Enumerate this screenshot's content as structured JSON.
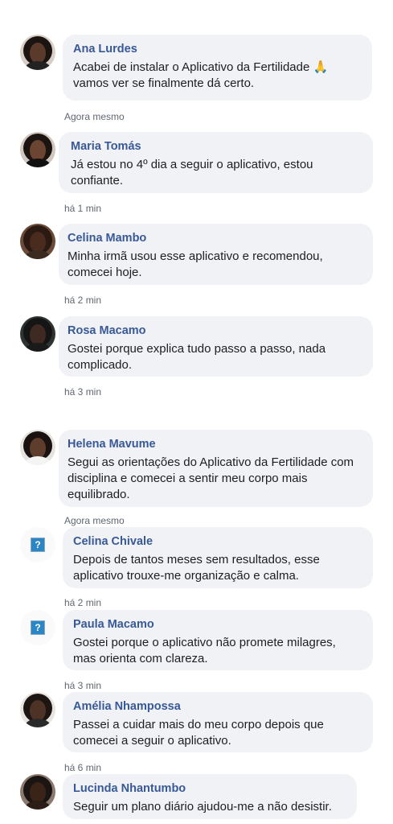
{
  "comments": [
    {
      "name": "Ana Lurdes",
      "text": "Acabei de instalar o Aplicativo da Fertilidade 🙏 vamos ver se finalmente dá certo.",
      "time": "Agora mesmo"
    },
    {
      "name": "Maria Tomás",
      "text": "Já estou no 4º dia a seguir o aplicativo, estou confiante.",
      "time": "há 1 min"
    },
    {
      "name": "Celina Mambo",
      "text": "Minha irmã usou esse aplicativo e recomendou, comecei hoje.",
      "time": "há 2 min"
    },
    {
      "name": "Rosa Macamo",
      "text": "Gostei porque explica tudo passo a passo, nada complicado.",
      "time": "há 3 min"
    },
    {
      "name": "Helena Mavume",
      "text": "Segui as orientações do Aplicativo da Fertilidade com disciplina e comecei a sentir meu corpo mais equilibrado.",
      "time": "Agora mesmo"
    },
    {
      "name": "Celina Chivale",
      "text": "Depois de tantos meses sem resultados, esse aplicativo trouxe-me organização e calma.",
      "time": "há 2 min"
    },
    {
      "name": "Paula Macamo",
      "text": "Gostei porque o aplicativo não promete milagres, mas orienta com clareza.",
      "time": "há 3 min"
    },
    {
      "name": "Amélia Nhampossa",
      "text": "Passei a cuidar mais do meu corpo depois que comecei a seguir o aplicativo.",
      "time": "há 6 min"
    },
    {
      "name": "Lucinda Nhantumbo",
      "text": "Seguir um plano diário ajudou-me a não desistir.",
      "time": ""
    }
  ],
  "placeholder_avatar_glyph": "?",
  "colors": {
    "name": "#385898",
    "bubble": "#f0f2f5",
    "time": "#606770",
    "text": "#1c1e21"
  }
}
